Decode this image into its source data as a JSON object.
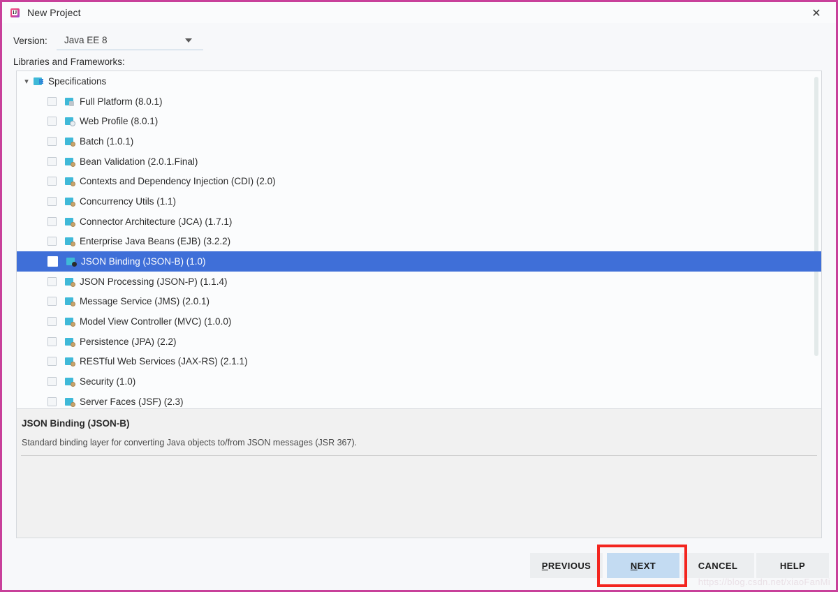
{
  "window": {
    "title": "New Project",
    "app_icon": "intellij-idea-icon",
    "close_label": "✕",
    "border_color": "#c8409a"
  },
  "form": {
    "version_label": "Version:",
    "version_value": "Java EE 8",
    "libraries_label": "Libraries and Frameworks:"
  },
  "tree": {
    "root": {
      "label": "Specifications",
      "expander": "⌄",
      "expanded": true
    },
    "items": [
      {
        "label": "Full Platform (8.0.1)",
        "checked": false,
        "selected": false,
        "icon": "platform-icon"
      },
      {
        "label": "Web Profile (8.0.1)",
        "checked": false,
        "selected": false,
        "icon": "web-profile-icon"
      },
      {
        "label": "Batch (1.0.1)",
        "checked": false,
        "selected": false,
        "icon": "spec-icon"
      },
      {
        "label": "Bean Validation (2.0.1.Final)",
        "checked": false,
        "selected": false,
        "icon": "spec-icon"
      },
      {
        "label": "Contexts and Dependency Injection (CDI) (2.0)",
        "checked": false,
        "selected": false,
        "icon": "spec-icon"
      },
      {
        "label": "Concurrency Utils (1.1)",
        "checked": false,
        "selected": false,
        "icon": "spec-icon"
      },
      {
        "label": "Connector Architecture (JCA) (1.7.1)",
        "checked": false,
        "selected": false,
        "icon": "spec-icon"
      },
      {
        "label": "Enterprise Java Beans (EJB) (3.2.2)",
        "checked": false,
        "selected": false,
        "icon": "spec-icon"
      },
      {
        "label": "JSON Binding (JSON-B) (1.0)",
        "checked": false,
        "selected": true,
        "icon": "spec-icon-dark"
      },
      {
        "label": "JSON Processing (JSON-P) (1.1.4)",
        "checked": false,
        "selected": false,
        "icon": "spec-icon"
      },
      {
        "label": "Message Service (JMS) (2.0.1)",
        "checked": false,
        "selected": false,
        "icon": "spec-icon"
      },
      {
        "label": "Model View Controller (MVC) (1.0.0)",
        "checked": false,
        "selected": false,
        "icon": "spec-icon"
      },
      {
        "label": "Persistence (JPA) (2.2)",
        "checked": false,
        "selected": false,
        "icon": "spec-icon"
      },
      {
        "label": "RESTful Web Services (JAX-RS) (2.1.1)",
        "checked": false,
        "selected": false,
        "icon": "spec-icon"
      },
      {
        "label": "Security (1.0)",
        "checked": false,
        "selected": false,
        "icon": "spec-icon"
      },
      {
        "label": "Server Faces (JSF) (2.3)",
        "checked": false,
        "selected": false,
        "icon": "spec-icon"
      }
    ],
    "selection_color": "#3f6fd8"
  },
  "description": {
    "title": "JSON Binding (JSON-B)",
    "text": "Standard binding layer for converting Java objects to/from JSON messages (JSR 367)."
  },
  "buttons": {
    "previous": {
      "label": "PREVIOUS",
      "mnemonic": "P",
      "rest": "REVIOUS"
    },
    "next": {
      "label": "NEXT",
      "mnemonic": "N",
      "rest": "EXT",
      "default": true,
      "highlight_color": "#f3251f"
    },
    "cancel": {
      "label": "CANCEL"
    },
    "help": {
      "label": "HELP"
    }
  },
  "watermark": {
    "text": "https://blog.csdn.net/xiaoFanMi"
  }
}
